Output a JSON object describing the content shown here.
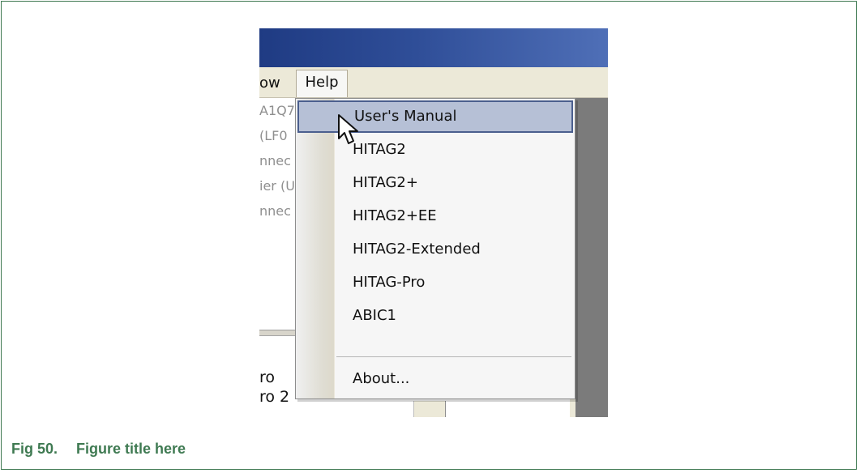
{
  "menu": {
    "partial_menu_label": "ow",
    "help_label": "Help",
    "help_items": [
      {
        "label": "User's Manual",
        "selected": true
      },
      {
        "label": "HITAG2",
        "selected": false
      },
      {
        "label": "HITAG2+",
        "selected": false
      },
      {
        "label": "HITAG2+EE",
        "selected": false
      },
      {
        "label": "HITAG2-Extended",
        "selected": false
      },
      {
        "label": "HITAG-Pro",
        "selected": false
      },
      {
        "label": "ABIC1",
        "selected": false
      },
      {
        "label": "About...",
        "selected": false
      }
    ]
  },
  "background_text": {
    "top_lines": [
      "A1Q7",
      "(LF0",
      "nnec",
      "ier (U",
      "nnec"
    ],
    "bottom_lines": [
      "ro",
      "ro 2"
    ]
  },
  "caption": {
    "number": "Fig 50.",
    "title": "Figure title here"
  },
  "colors": {
    "caption_green": "#3f7a52",
    "selection_fill": "#b6c0d6",
    "selection_border": "#4b5f8e",
    "titlebar_blue": "#2f4e98"
  },
  "icons": {
    "cursor": "mouse-pointer-icon"
  }
}
